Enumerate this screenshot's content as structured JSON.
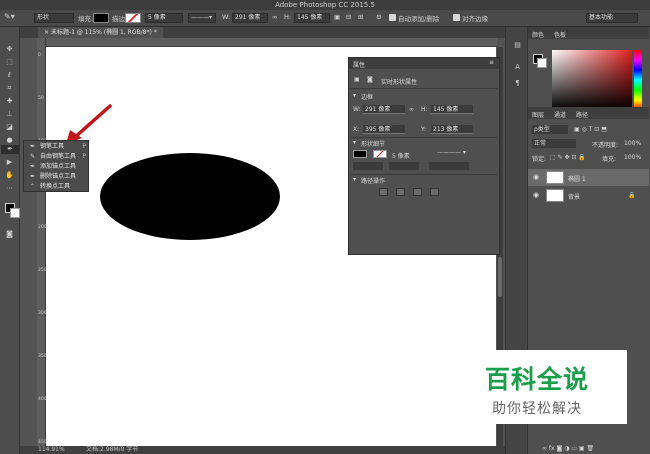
{
  "app": {
    "title": "Adobe Photoshop CC 2015.5"
  },
  "options_bar": {
    "mode": "形状",
    "fill_label": "填充:",
    "stroke_label": "描边:",
    "stroke_size": "5 像素",
    "w_label": "W:",
    "w_value": "291 像素",
    "h_label": "H:",
    "h_value": "145 像素",
    "auto_add_delete": "自动添加/删除",
    "align_edges": "对齐边缘",
    "workspace": "基本功能"
  },
  "document": {
    "tab_title": "未标题-1 @ 115% (椭圆 1, RGB/8*) *",
    "zoom": "114.91%",
    "doc_info": "文档:2.98M/0 字节"
  },
  "rulers": {
    "v_ticks": [
      "0",
      "50",
      "100",
      "150",
      "200",
      "250",
      "300",
      "350",
      "400",
      "450"
    ]
  },
  "pen_menu": {
    "items": [
      {
        "label": "钢笔工具",
        "shortcut": "P"
      },
      {
        "label": "自由钢笔工具",
        "shortcut": "P"
      },
      {
        "label": "添加锚点工具",
        "shortcut": ""
      },
      {
        "label": "删除锚点工具",
        "shortcut": ""
      },
      {
        "label": "转换点工具",
        "shortcut": ""
      }
    ]
  },
  "properties": {
    "tab": "属性",
    "subtitle": "实时形状属性",
    "section_bbox": "边框",
    "w_label": "W:",
    "w_value": "291 像素",
    "h_label": "H:",
    "h_value": "145 像素",
    "x_label": "X:",
    "x_value": "395 像素",
    "y_label": "Y:",
    "y_value": "213 像素",
    "section_appearance": "形状细节",
    "stroke_size": "5 像素",
    "section_path_ops": "路径操作"
  },
  "color_panel": {
    "tab_color": "颜色",
    "tab_swatches": "色板"
  },
  "layers_panel": {
    "tab_layers": "图层",
    "tab_channels": "通道",
    "tab_paths": "路径",
    "filter": "ρ类型",
    "blend_mode": "正常",
    "opacity_label": "不透明度:",
    "opacity_value": "100%",
    "lock_label": "锁定:",
    "fill_label": "填充:",
    "fill_value": "100%",
    "layers": [
      {
        "name": "椭圆 1"
      },
      {
        "name": "背景"
      }
    ]
  },
  "watermark": {
    "main": "百科全说",
    "sub": "助你轻松解决"
  }
}
